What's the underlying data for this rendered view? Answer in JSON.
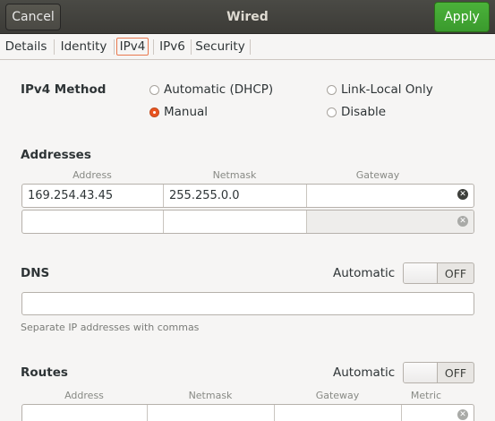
{
  "header": {
    "title": "Wired",
    "cancel_label": "Cancel",
    "apply_label": "Apply",
    "accent_apply": "#3ea42f"
  },
  "tabs": [
    {
      "label": "Details"
    },
    {
      "label": "Identity"
    },
    {
      "label": "IPv4",
      "active": true
    },
    {
      "label": "IPv6"
    },
    {
      "label": "Security"
    }
  ],
  "ipv4_method": {
    "label": "IPv4 Method",
    "options": [
      {
        "label": "Automatic (DHCP)",
        "checked": false
      },
      {
        "label": "Link-Local Only",
        "checked": false
      },
      {
        "label": "Manual",
        "checked": true
      },
      {
        "label": "Disable",
        "checked": false
      }
    ]
  },
  "addresses": {
    "label": "Addresses",
    "columns": [
      "Address",
      "Netmask",
      "Gateway"
    ],
    "rows": [
      {
        "address": "169.254.43.45",
        "netmask": "255.255.0.0",
        "gateway": ""
      },
      {
        "address": "",
        "netmask": "",
        "gateway": ""
      }
    ]
  },
  "dns": {
    "label": "DNS",
    "automatic_label": "Automatic",
    "switch_state": "OFF",
    "value": "",
    "hint": "Separate IP addresses with commas"
  },
  "routes": {
    "label": "Routes",
    "automatic_label": "Automatic",
    "switch_state": "OFF",
    "columns": [
      "Address",
      "Netmask",
      "Gateway",
      "Metric"
    ]
  },
  "icons": {
    "delete_row": "close-circle-icon",
    "radio_checked_color": "#e95420"
  }
}
